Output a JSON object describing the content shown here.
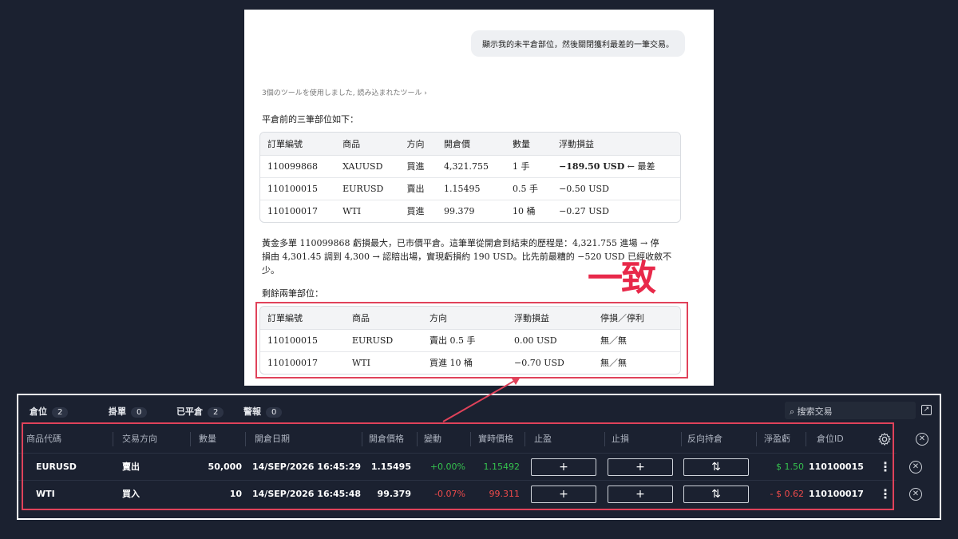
{
  "chat": {
    "user_message": "顯示我的未平倉部位，然後關閉獲利最差的一筆交易。",
    "tools_note": "3個のツールを使用しました, 読み込まれたツール ›",
    "intro": "平倉前的三筆部位如下：",
    "table1": {
      "headers": [
        "訂單編號",
        "商品",
        "方向",
        "開倉價",
        "數量",
        "浮動損益"
      ],
      "rows": [
        [
          "110099868",
          "XAUUSD",
          "買進",
          "4,321.755",
          "1 手",
          "−189.50 USD"
        ],
        [
          "110100015",
          "EURUSD",
          "賣出",
          "1.15495",
          "0.5 手",
          "−0.50 USD"
        ],
        [
          "110100017",
          "WTI",
          "買進",
          "99.379",
          "10 桶",
          "−0.27 USD"
        ]
      ],
      "worst_note": "← 最差"
    },
    "summary_line1": "黃金多單 110099868 虧損最大，已市價平倉。這筆單從開倉到結束的歷程是：4,321.755 進場 → 停",
    "summary_line2": "損由 4,301.45 調到 4,300 → 認賠出場，實現虧損約 190 USD。比先前最糟的 −520 USD 已經收斂不",
    "summary_line3": "少。",
    "remaining_title": "剩餘兩筆部位：",
    "table2": {
      "headers": [
        "訂單編號",
        "商品",
        "方向",
        "浮動損益",
        "停損／停利"
      ],
      "rows": [
        [
          "110100015",
          "EURUSD",
          "賣出 0.5 手",
          "0.00 USD",
          "無／無"
        ],
        [
          "110100017",
          "WTI",
          "買進 10 桶",
          "−0.70 USD",
          "無／無"
        ]
      ]
    }
  },
  "annotation": {
    "label": "一致",
    "color": "#e8294a"
  },
  "terminal": {
    "tabs": [
      {
        "label": "倉位",
        "count": "2"
      },
      {
        "label": "掛單",
        "count": "0"
      },
      {
        "label": "已平倉",
        "count": "2"
      },
      {
        "label": "警報",
        "count": "0"
      }
    ],
    "search_placeholder": "搜索交易",
    "headers": [
      "商品代碼",
      "交易方向",
      "數量",
      "開倉日期",
      "開倉價格",
      "變動",
      "實時價格",
      "止盈",
      "止損",
      "反向持倉",
      "淨盈虧",
      "倉位ID"
    ],
    "rows": [
      {
        "symbol": "EURUSD",
        "side": "賣出",
        "qty": "50,000",
        "date": "14/SEP/2026 16:45:29",
        "open": "1.15495",
        "change": "+0.00%",
        "price": "1.15492",
        "tp": "+",
        "sl": "+",
        "reverse": "⇅",
        "pnl": "$ 1.50",
        "id": "110100015"
      },
      {
        "symbol": "WTI",
        "side": "買入",
        "qty": "10",
        "date": "14/SEP/2026 16:45:48",
        "open": "99.379",
        "change": "-0.07%",
        "price": "99.311",
        "tp": "+",
        "sl": "+",
        "reverse": "⇅",
        "pnl": "- $ 0.62",
        "id": "110100017"
      }
    ],
    "colors": {
      "positive": "#35c24e",
      "negative": "#ef4b4b",
      "background": "#1b2130"
    }
  }
}
